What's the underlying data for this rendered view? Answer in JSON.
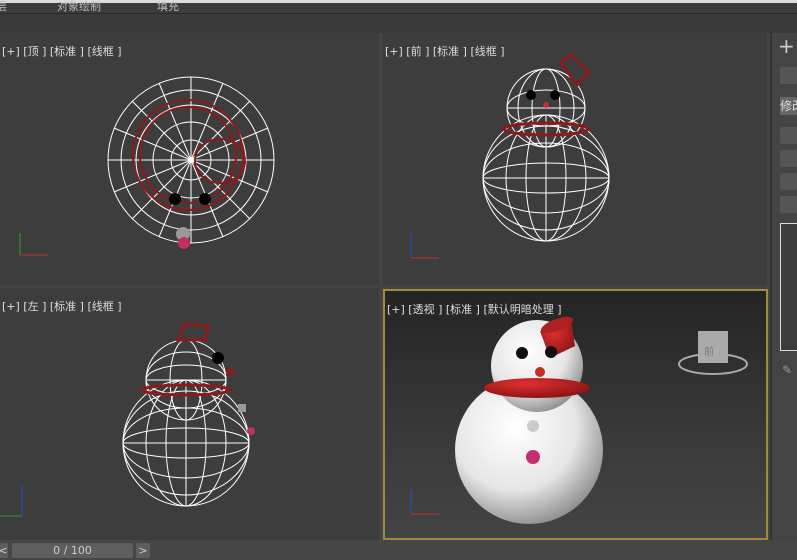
{
  "menubar": {
    "items": [
      "层",
      "对象绘制",
      "填充"
    ]
  },
  "viewports": [
    {
      "label": "[+] [顶 ] [标准 ] [线框 ]",
      "axes": [
        "x",
        "y"
      ]
    },
    {
      "label": "[+] [前 ] [标准 ] [线框 ]",
      "axes": [
        "x",
        "z"
      ]
    },
    {
      "label": "[+] [左 ] [标准 ] [线框 ]",
      "axes": [
        "y",
        "z"
      ]
    },
    {
      "label": "[+] [透视 ] [标准 ] [默认明暗处理 ]",
      "axes": [
        "x",
        "z"
      ],
      "viewcube": "前"
    }
  ],
  "command_panel": {
    "tab": "修改",
    "add_icon": "plus-icon"
  },
  "timeline": {
    "prev": "<",
    "frame": "0 / 100",
    "next": ">"
  },
  "colors": {
    "wire": "#ffffff",
    "hat": "#8b1a1a",
    "active_border": "#a08a3c"
  }
}
